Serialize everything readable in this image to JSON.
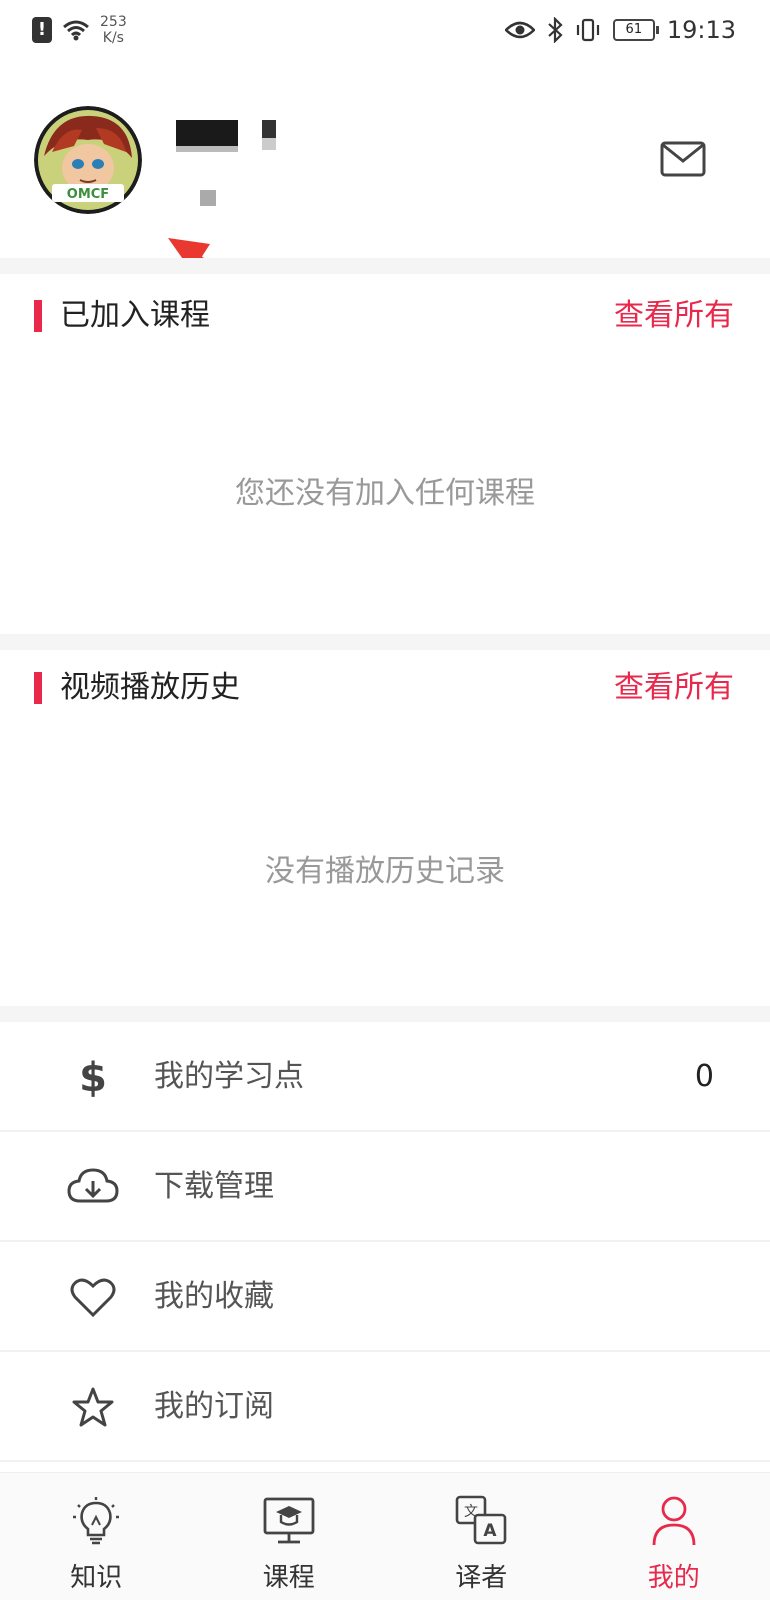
{
  "status_bar": {
    "speed_value": "253",
    "speed_unit": "K/s",
    "battery": "61",
    "time": "19:13"
  },
  "courses": {
    "title": "已加入课程",
    "view_all": "查看所有",
    "empty_text": "您还没有加入任何课程"
  },
  "history": {
    "title": "视频播放历史",
    "view_all": "查看所有",
    "empty_text": "没有播放历史记录"
  },
  "menu": [
    {
      "label": "我的学习点",
      "value": "0",
      "icon": "dollar-icon"
    },
    {
      "label": "下载管理",
      "icon": "cloud-download-icon"
    },
    {
      "label": "我的收藏",
      "icon": "heart-icon"
    },
    {
      "label": "我的订阅",
      "icon": "star-icon"
    }
  ],
  "tabs": [
    {
      "label": "知识",
      "icon": "lightbulb-icon"
    },
    {
      "label": "课程",
      "icon": "monitor-graduation-icon"
    },
    {
      "label": "译者",
      "icon": "translate-icon"
    },
    {
      "label": "我的",
      "icon": "person-icon",
      "active": true
    }
  ],
  "accent_color": "#e8294c"
}
